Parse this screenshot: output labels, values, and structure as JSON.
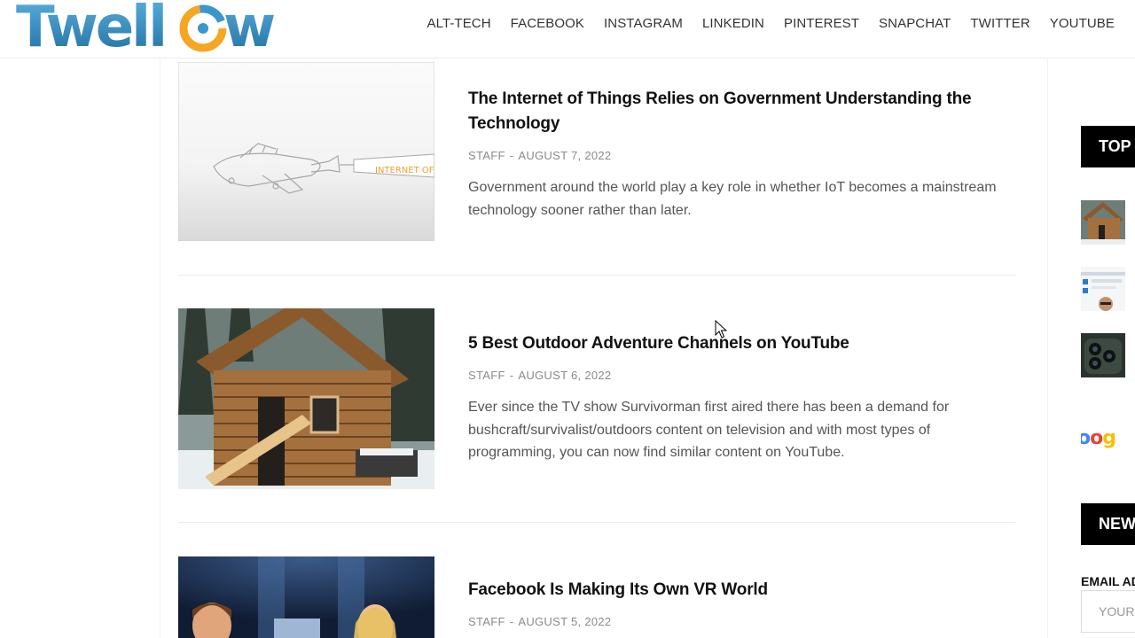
{
  "site": {
    "logo_text": "Twellow"
  },
  "nav": {
    "items": [
      "ALT-TECH",
      "FACEBOOK",
      "INSTAGRAM",
      "LINKEDIN",
      "PINTEREST",
      "SNAPCHAT",
      "TWITTER",
      "YOUTUBE"
    ]
  },
  "posts": [
    {
      "title": "The Internet of Things Relies on Government Understanding the Technology",
      "author": "STAFF",
      "separator": "-",
      "date": "AUGUST 7, 2022",
      "excerpt": "Government around the world play a key role in whether IoT becomes a mainstream technology sooner rather than later.",
      "banner_text": "INTERNET OF TH"
    },
    {
      "title": "5 Best Outdoor Adventure Channels on YouTube",
      "author": "STAFF",
      "separator": "-",
      "date": "AUGUST 6, 2022",
      "excerpt": "Ever since the TV show Survivorman first aired there has been a demand for bushcraft/survivalist/outdoors content on television and with most types of programming, you can now find similar content on YouTube."
    },
    {
      "title": "Facebook Is Making Its Own VR World",
      "author": "STAFF",
      "separator": "-",
      "date": "AUGUST 5, 2022",
      "excerpt": ""
    }
  ],
  "sidebar": {
    "top_heading": "TOP",
    "news_heading": "NEWS",
    "email_label": "EMAIL AD",
    "email_placeholder": "YOUR",
    "google_partial": "oog"
  },
  "colors": {
    "brand_blue": "#2f86b8",
    "logo_orange": "#f5a623",
    "widget_head_bg": "#000000"
  }
}
